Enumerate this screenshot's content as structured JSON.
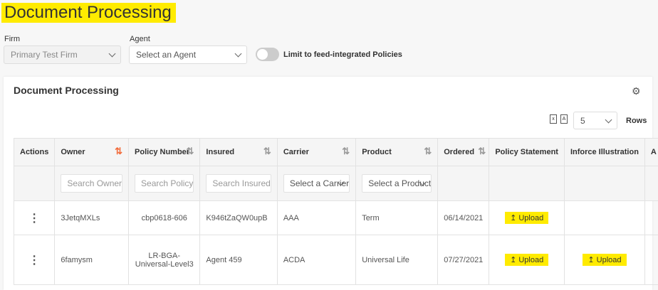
{
  "page_title": "Document Processing",
  "filters": {
    "firm_label": "Firm",
    "firm_value": "Primary Test Firm",
    "agent_label": "Agent",
    "agent_placeholder": "Select an Agent",
    "toggle_label": "Limit to feed-integrated Policies",
    "toggle_on": false
  },
  "card": {
    "title": "Document Processing",
    "rows_value": "5",
    "rows_label": "Rows",
    "export_icons": [
      "excel-icon",
      "pdf-icon"
    ]
  },
  "table": {
    "columns": [
      "Actions",
      "Owner",
      "Policy Number",
      "Insured",
      "Carrier",
      "Product",
      "Ordered",
      "Policy Statement",
      "Inforce Illustration",
      "A"
    ],
    "filters": {
      "owner": "Search Owner",
      "policy": "Search Policy",
      "insured": "Search Insured",
      "carrier": "Select a Carrier",
      "product": "Select a Product"
    },
    "rows": [
      {
        "owner": "3JetqMXLs",
        "policy": "cbp0618-606",
        "insured": "K946tZaQW0upB",
        "carrier": "AAA",
        "product": "Term",
        "ordered": "06/14/2021",
        "policy_statement": "Upload",
        "inforce": ""
      },
      {
        "owner": "6famysm",
        "policy": "LR-BGA-Universal-Level3",
        "insured": "Agent 459",
        "carrier": "ACDA",
        "product": "Universal Life",
        "ordered": "07/27/2021",
        "policy_statement": "Upload",
        "inforce": "Upload"
      }
    ]
  },
  "colors": {
    "highlight": "#ffeb00",
    "link": "#1ab0e8",
    "sort_active": "#f26b3a"
  }
}
